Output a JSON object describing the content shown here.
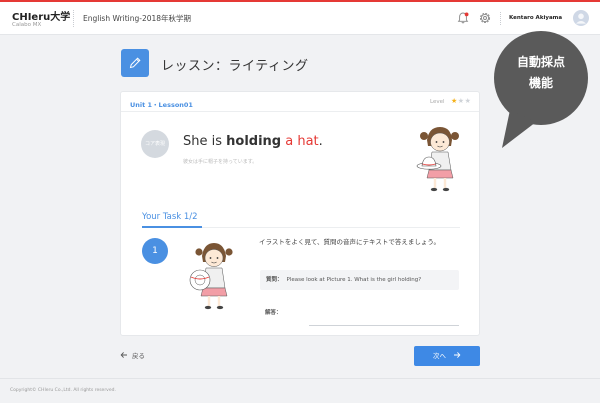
{
  "header": {
    "logo": "CHIeru大学",
    "logo_sub": "Calabo MX",
    "course_title": "English Writing-2018年秋学期",
    "username": "Kentaro Akiyama"
  },
  "page": {
    "title": "レッスン：ライティング"
  },
  "callout": {
    "line1": "自動採点",
    "line2": "機能"
  },
  "card": {
    "unit": "Unit 1・Lesson01",
    "level_label": "Level",
    "level": {
      "filled": 1,
      "total": 3
    },
    "core_label": "コア表現",
    "sentence": {
      "pre": "She is ",
      "bold": "holding",
      "space": " ",
      "red": "a hat",
      "post": "."
    },
    "translation": "彼女は手に帽子を持っています。"
  },
  "task": {
    "title": "Your Task 1/2",
    "number": "1",
    "instruction": "イラストをよく見て、質問の音声にテキストで答えましょう。",
    "question_label": "質問：",
    "question": "Please look at Picture 1. What is the girl holding?",
    "answer_label": "解答："
  },
  "nav": {
    "back": "戻る",
    "next": "次へ"
  },
  "footer": {
    "copyright": "Copyright© CHIeru Co.,Ltd. All rights reserved."
  },
  "colors": {
    "accent": "#4a90e2",
    "brand_red": "#e53935",
    "star_filled": "#f5b21b",
    "star_empty": "#cfd3d8",
    "callout_bg": "#5a5a5a"
  },
  "icons": [
    "pencil-icon",
    "bell-icon",
    "gear-icon",
    "avatar-icon",
    "arrow-left-icon",
    "arrow-right-icon"
  ]
}
